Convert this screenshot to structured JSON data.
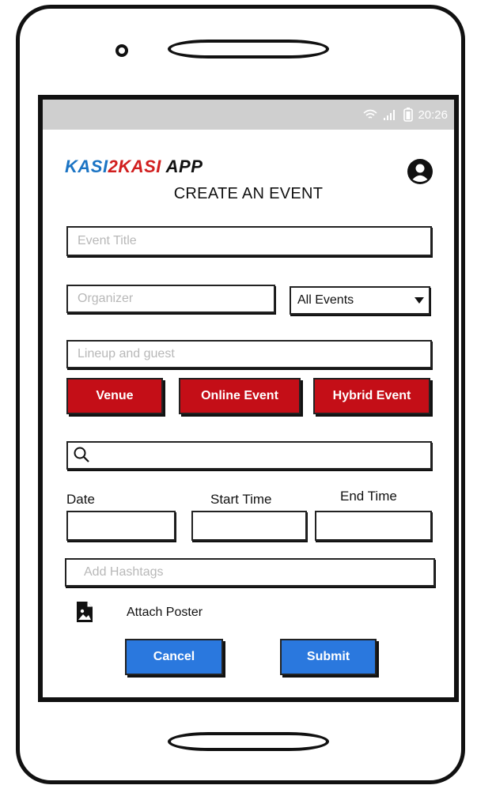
{
  "status_bar": {
    "time": "20:26"
  },
  "header": {
    "brand_part1": "KASI",
    "brand_part2": "2",
    "brand_part3": "KASI",
    "brand_part4": " APP",
    "title": "CREATE AN EVENT"
  },
  "form": {
    "event_title_placeholder": "Event Title",
    "organizer_placeholder": "Organizer",
    "category_selected": "All Events",
    "lineup_placeholder": "Lineup and guest",
    "location_buttons": [
      "Venue",
      "Online Event",
      "Hybrid Event"
    ],
    "search_placeholder": "",
    "date_label": "Date",
    "start_time_label": "Start Time",
    "end_time_label": "End Time",
    "hashtags_placeholder": "Add Hashtags",
    "attach_label": "Attach Poster"
  },
  "actions": {
    "cancel": "Cancel",
    "submit": "Submit"
  },
  "colors": {
    "brand_blue": "#1b74c4",
    "brand_red": "#d11f1f",
    "button_red": "#c40e17",
    "button_blue": "#2a78de",
    "status_bar": "#cfcfcf"
  },
  "icons": [
    "wifi-icon",
    "signal-icon",
    "battery-icon",
    "user-icon",
    "search-icon",
    "image-file-icon",
    "dropdown-arrow-icon"
  ]
}
